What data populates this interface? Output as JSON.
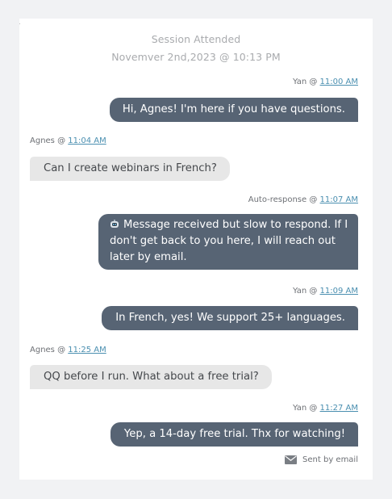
{
  "session": {
    "title": "Session Attended",
    "date": "Novemver 2nd,2023 @ 10:13 PM"
  },
  "messages": [
    {
      "sender": "Yan @ ",
      "time": "11:00 AM",
      "text": "Hi, Agnes! I'm here if you have questions."
    },
    {
      "sender": "Agnes @ ",
      "time": "11:04 AM",
      "text": "Can I create webinars in French?"
    },
    {
      "sender": "Auto-response @ ",
      "time": "11:07 AM",
      "text": "Message received but slow to respond. If I don't get back to you here, I will reach out later by email."
    },
    {
      "sender": "Yan @ ",
      "time": "11:09 AM",
      "text": "In French, yes! We support 25+ languages."
    },
    {
      "sender": "Agnes @ ",
      "time": "11:25 AM",
      "text": "QQ before I run. What about a free trial?"
    },
    {
      "sender": "Yan @ ",
      "time": "11:27 AM",
      "text": "Yep, a 14-day free trial. Thx for watching!"
    }
  ],
  "footer": {
    "icon": "envelope-icon",
    "label": "Sent by email"
  },
  "colors": {
    "outgoing_bubble": "#576474",
    "incoming_bubble": "#e7e7e7",
    "time_link": "#4a8fb0"
  }
}
